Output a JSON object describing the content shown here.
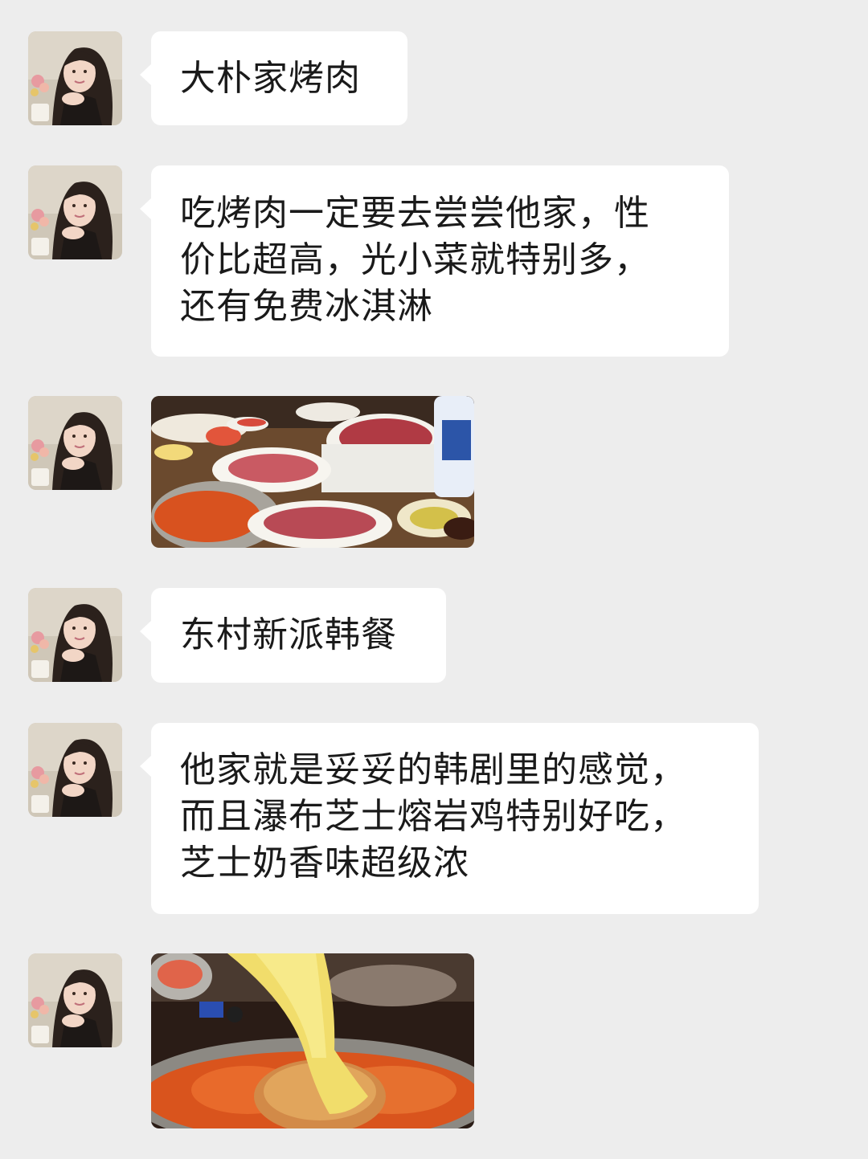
{
  "chat": {
    "messages": [
      {
        "type": "text",
        "text": "大朴家烤肉"
      },
      {
        "type": "text",
        "text": "吃烤肉一定要去尝尝他家，性\n价比超高，光小菜就特别多，\n还有免费冰淇淋"
      },
      {
        "type": "image",
        "content": "korean-bbq-meat-platter-photo"
      },
      {
        "type": "text",
        "text": "东村新派韩餐"
      },
      {
        "type": "text",
        "text": "他家就是妥妥的韩剧里的感觉，\n而且瀑布芝士熔岩鸡特别好吃，\n芝士奶香味超级浓"
      },
      {
        "type": "image",
        "content": "cheese-lava-chicken-photo"
      }
    ]
  },
  "colors": {
    "background": "#ededed",
    "bubble": "#ffffff",
    "text": "#1a1a1a"
  },
  "icons": {
    "avatar": "girl-portrait-avatar"
  }
}
